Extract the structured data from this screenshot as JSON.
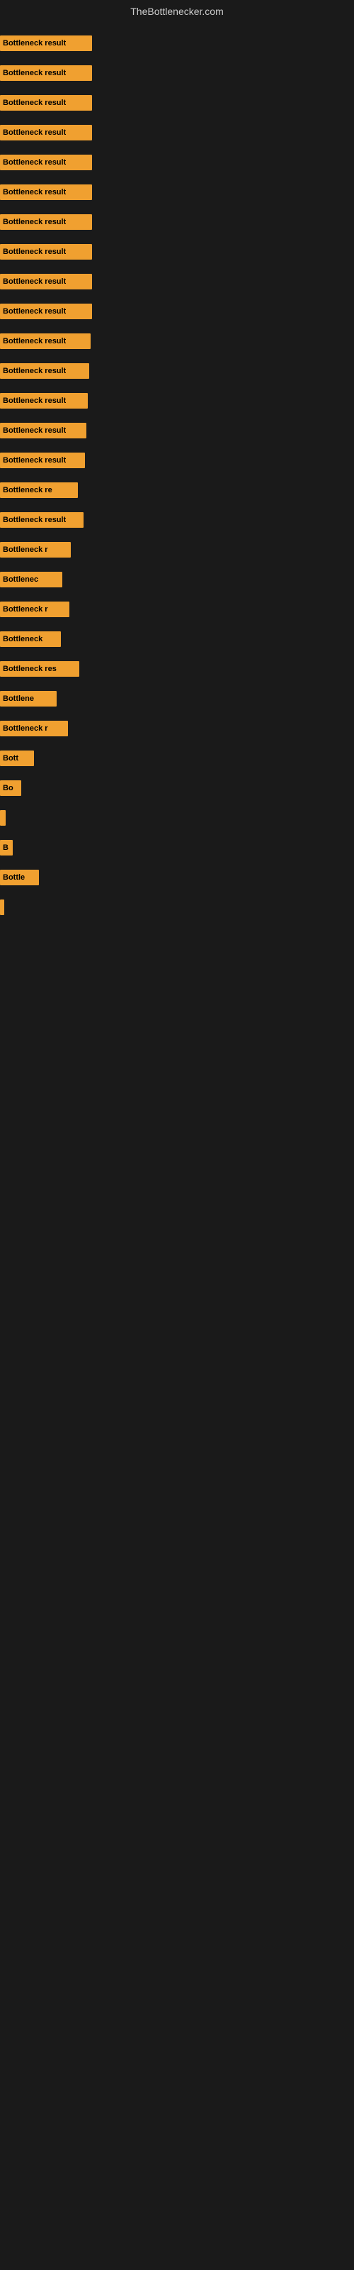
{
  "site": {
    "title": "TheBottlenecker.com"
  },
  "bars": [
    {
      "label": "Bottleneck result",
      "width": 130,
      "gap": 18
    },
    {
      "label": "Bottleneck result",
      "width": 130,
      "gap": 18
    },
    {
      "label": "Bottleneck result",
      "width": 130,
      "gap": 18
    },
    {
      "label": "Bottleneck result",
      "width": 130,
      "gap": 18
    },
    {
      "label": "Bottleneck result",
      "width": 130,
      "gap": 18
    },
    {
      "label": "Bottleneck result",
      "width": 130,
      "gap": 18
    },
    {
      "label": "Bottleneck result",
      "width": 130,
      "gap": 18
    },
    {
      "label": "Bottleneck result",
      "width": 130,
      "gap": 18
    },
    {
      "label": "Bottleneck result",
      "width": 130,
      "gap": 18
    },
    {
      "label": "Bottleneck result",
      "width": 130,
      "gap": 18
    },
    {
      "label": "Bottleneck result",
      "width": 128,
      "gap": 18
    },
    {
      "label": "Bottleneck result",
      "width": 126,
      "gap": 18
    },
    {
      "label": "Bottleneck result",
      "width": 124,
      "gap": 18
    },
    {
      "label": "Bottleneck result",
      "width": 122,
      "gap": 18
    },
    {
      "label": "Bottleneck result",
      "width": 120,
      "gap": 18
    },
    {
      "label": "Bottleneck re",
      "width": 110,
      "gap": 18
    },
    {
      "label": "Bottleneck result",
      "width": 118,
      "gap": 18
    },
    {
      "label": "Bottleneck r",
      "width": 100,
      "gap": 18
    },
    {
      "label": "Bottlenec",
      "width": 88,
      "gap": 18
    },
    {
      "label": "Bottleneck r",
      "width": 98,
      "gap": 18
    },
    {
      "label": "Bottleneck",
      "width": 86,
      "gap": 18
    },
    {
      "label": "Bottleneck res",
      "width": 112,
      "gap": 18
    },
    {
      "label": "Bottlene",
      "width": 80,
      "gap": 18
    },
    {
      "label": "Bottleneck r",
      "width": 96,
      "gap": 18
    },
    {
      "label": "Bott",
      "width": 48,
      "gap": 18
    },
    {
      "label": "Bo",
      "width": 30,
      "gap": 18
    },
    {
      "label": "",
      "width": 8,
      "gap": 18
    },
    {
      "label": "B",
      "width": 18,
      "gap": 18
    },
    {
      "label": "Bottle",
      "width": 55,
      "gap": 18
    },
    {
      "label": "",
      "width": 6,
      "gap": 18
    }
  ]
}
